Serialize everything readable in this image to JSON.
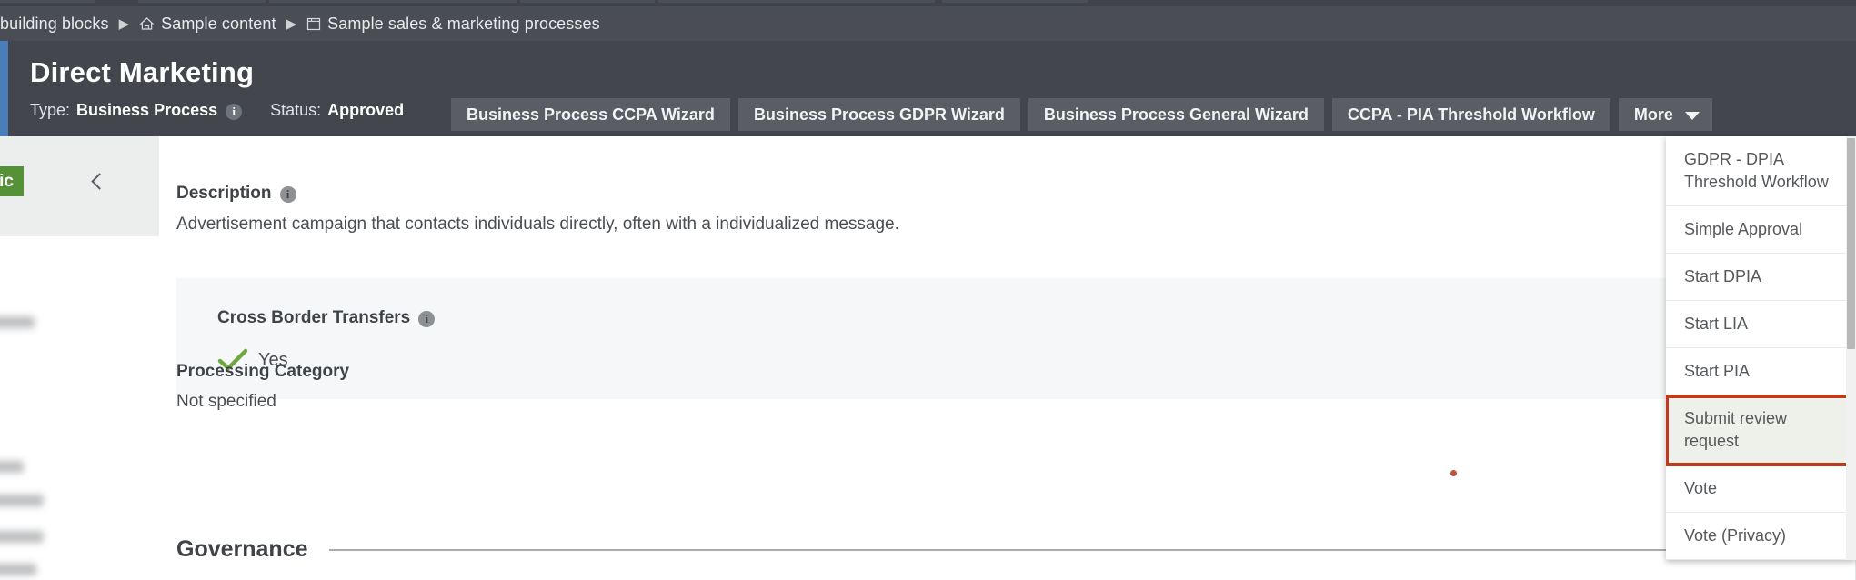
{
  "breadcrumb": {
    "items": [
      {
        "label": "building blocks",
        "icon": "none"
      },
      {
        "label": "Sample content",
        "icon": "home-icon"
      },
      {
        "label": "Sample sales & marketing processes",
        "icon": "folder-icon"
      }
    ],
    "separator": "▶"
  },
  "header": {
    "title": "Direct Marketing",
    "type_label": "Type:",
    "type_value": "Business Process",
    "type_info_icon": "info-icon",
    "status_label": "Status:",
    "status_value": "Approved",
    "accent_color": "#4a7ebb",
    "background_color": "#43474d"
  },
  "action_tabs": [
    {
      "label": "Business Process CCPA Wizard"
    },
    {
      "label": "Business Process GDPR Wizard"
    },
    {
      "label": "Business Process General Wizard"
    },
    {
      "label": "CCPA - PIA Threshold Workflow"
    }
  ],
  "more_button": {
    "label": "More",
    "caret_icon": "chevron-down-icon"
  },
  "dropdown": {
    "items": [
      {
        "label": "GDPR - DPIA Threshold Workflow",
        "highlighted": false
      },
      {
        "label": "Simple Approval",
        "highlighted": false
      },
      {
        "label": "Start DPIA",
        "highlighted": false
      },
      {
        "label": "Start LIA",
        "highlighted": false
      },
      {
        "label": "Start PIA",
        "highlighted": false
      },
      {
        "label": "Submit review request",
        "highlighted": true
      },
      {
        "label": "Vote",
        "highlighted": false
      },
      {
        "label": "Vote (Privacy)",
        "highlighted": false
      }
    ],
    "highlight_border_color": "#c0391b",
    "highlight_background_color": "#eef1ea",
    "scrollbar": "vertical-scrollbar"
  },
  "sidebar": {
    "badge_label": "eristic",
    "badge_color": "#559137",
    "collapse_icon": "chevron-left-icon"
  },
  "main": {
    "description": {
      "label": "Description",
      "info_icon": "info-icon",
      "text": "Advertisement campaign that contacts individuals directly, often with a individualized message."
    },
    "cross_border": {
      "label": "Cross Border Transfers",
      "info_icon": "info-icon",
      "check_icon": "check-icon",
      "value": "Yes",
      "check_color": "#6ea83e"
    },
    "processing_category": {
      "label": "Processing Category",
      "value": "Not specified"
    },
    "governance": {
      "title": "Governance"
    },
    "marker": {
      "name": "red-dot-marker",
      "color": "#c0533c"
    }
  }
}
